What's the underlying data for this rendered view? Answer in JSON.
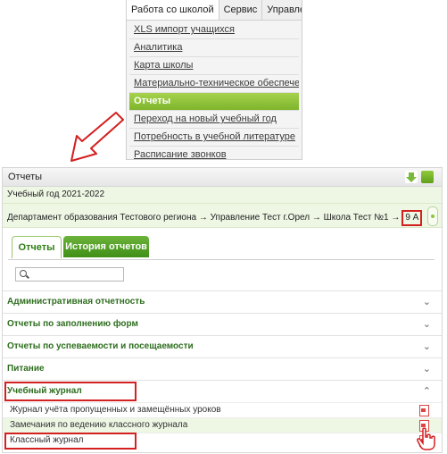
{
  "menu": {
    "tabs": [
      "Работа со школой",
      "Сервис",
      "Управлен"
    ],
    "items": [
      "XLS импорт учащихся",
      "Аналитика",
      "Карта школы",
      "Материально-техническое обеспечение",
      "Отчеты",
      "Переход на новый учебный год",
      "Потребность в учебной литературе",
      "Расписание звонков"
    ],
    "active_item": "Отчеты"
  },
  "panel": {
    "title": "Отчеты",
    "year": "Учебный год 2021-2022",
    "path": "Департамент образования Тестового региона → Управление Тест г.Орел → Школа Тест №1 →",
    "class": "9 А",
    "tabs": [
      "Отчеты",
      "История отчетов"
    ],
    "sections": [
      "Административная отчетность",
      "Отчеты по заполнению форм",
      "Отчеты по успеваемости и посещаемости",
      "Питание",
      "Учебный журнал"
    ],
    "journal_items": [
      "Журнал учёта пропущенных и замещённых уроков",
      "Замечания по ведению классного журнала",
      "Классный журнал"
    ]
  },
  "colors": {
    "accent": "#8fc43c",
    "highlight": "#d32020",
    "link": "#2e6e1e"
  }
}
